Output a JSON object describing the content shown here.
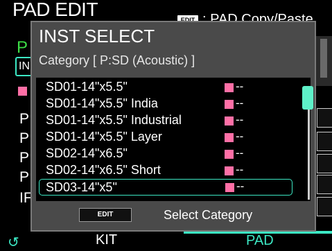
{
  "background": {
    "title": "PAD EDIT",
    "edit_badge": "EDIT",
    "subtitle": ": PAD Copy/Paste",
    "p_green": "P",
    "in_label": "IN",
    "left_labels": [
      "P",
      "P",
      "P",
      "P",
      "IF"
    ]
  },
  "dialog": {
    "title": "INST SELECT",
    "category": "Category [ P:SD (Acoustic) ]",
    "items": [
      {
        "name": "SD01-14\"x5.5\"",
        "value": "--"
      },
      {
        "name": "SD01-14\"x5.5\" India",
        "value": "--"
      },
      {
        "name": "SD01-14\"x5.5\" Industrial",
        "value": "--"
      },
      {
        "name": "SD01-14\"x5.5\" Layer",
        "value": "--"
      },
      {
        "name": "SD02-14\"x6.5\"",
        "value": "--"
      },
      {
        "name": "SD02-14\"x6.5\" Short",
        "value": "--"
      },
      {
        "name": "SD03-14\"x5\"",
        "value": "--"
      }
    ],
    "selected_index": 6,
    "edit_button": "EDIT",
    "edit_button_label": "Select Category"
  },
  "footer": {
    "refresh_icon": "↺",
    "kit_tab": "KIT",
    "pad_tab": "PAD"
  },
  "colors": {
    "accent": "#3ce8c4",
    "swatch": "#ff6fa6",
    "dialog_bg": "#4a4a4a"
  }
}
